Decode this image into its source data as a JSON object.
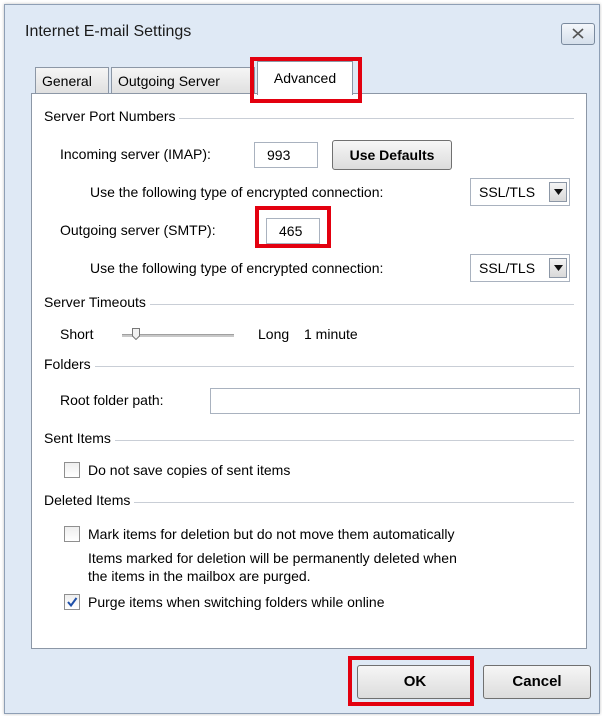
{
  "window": {
    "title": "Internet E-mail Settings"
  },
  "tabs": [
    {
      "label": "General",
      "active": false
    },
    {
      "label": "Outgoing Server",
      "active": false
    },
    {
      "label": "Advanced",
      "active": true
    }
  ],
  "server_ports": {
    "group_title": "Server Port Numbers",
    "incoming_label": "Incoming server (IMAP):",
    "incoming_value": "993",
    "use_defaults_label": "Use Defaults",
    "encryption_label_1": "Use the following type of encrypted connection:",
    "encryption_value_1": "SSL/TLS",
    "outgoing_label": "Outgoing server (SMTP):",
    "outgoing_value": "465",
    "encryption_label_2": "Use the following type of encrypted connection:",
    "encryption_value_2": "SSL/TLS"
  },
  "timeouts": {
    "group_title": "Server Timeouts",
    "short_label": "Short",
    "long_label": "Long",
    "value_label": "1 minute"
  },
  "folders": {
    "group_title": "Folders",
    "root_label": "Root folder path:",
    "root_value": ""
  },
  "sent_items": {
    "group_title": "Sent Items",
    "no_copies_label": "Do not save copies of sent items",
    "no_copies_checked": false
  },
  "deleted_items": {
    "group_title": "Deleted Items",
    "mark_label": "Mark items for deletion but do not move them automatically",
    "mark_checked": false,
    "note_line1": "Items marked for deletion will be permanently deleted when",
    "note_line2": "the items in the mailbox are purged.",
    "purge_label": "Purge items when switching folders while online",
    "purge_checked": true
  },
  "footer": {
    "ok_label": "OK",
    "cancel_label": "Cancel"
  },
  "colors": {
    "highlight": "#e3000f",
    "dialog_bg": "#dfe9f5",
    "check": "#1e4fa8"
  },
  "icons": [
    "close-icon",
    "dropdown-arrow-icon",
    "checkmark-icon",
    "slider-thumb-icon"
  ]
}
